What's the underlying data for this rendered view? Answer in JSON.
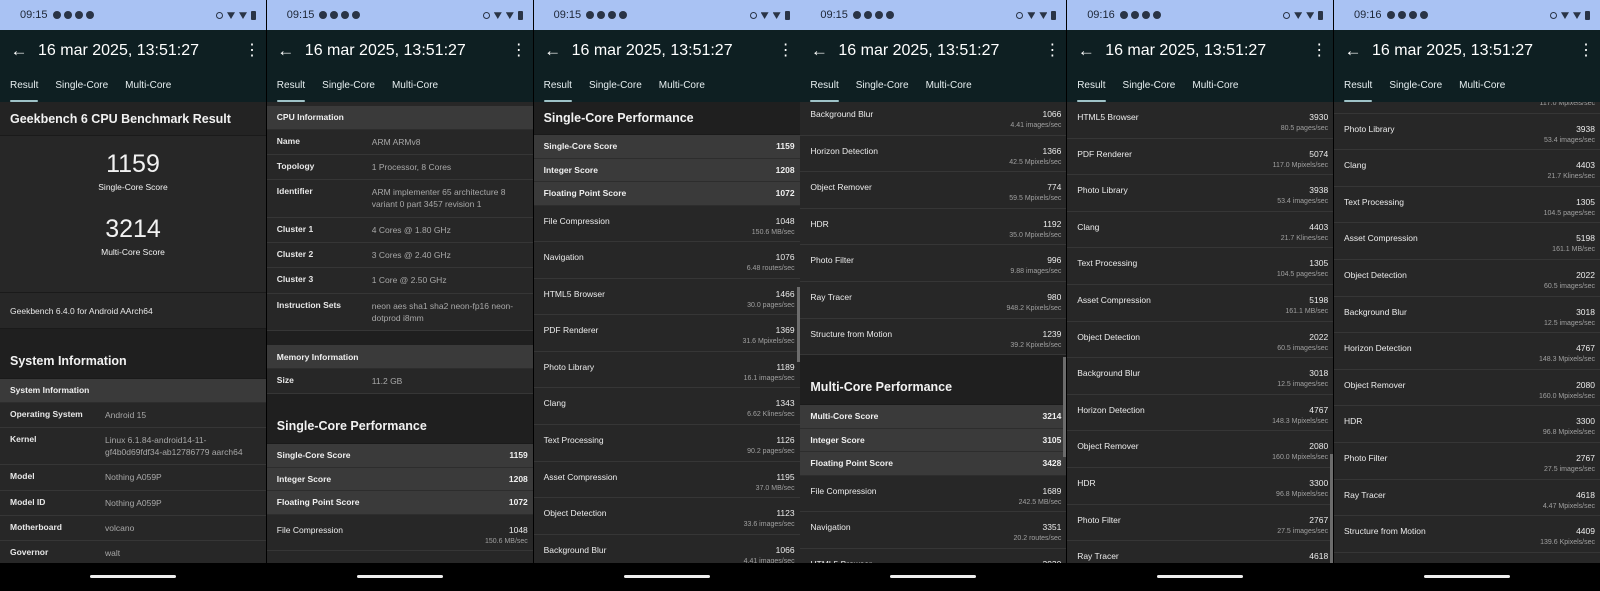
{
  "status": {
    "times": [
      "09:15",
      "09:15",
      "09:15",
      "09:15",
      "09:16",
      "09:16"
    ]
  },
  "app": {
    "title": "16 mar 2025, 13:51:27",
    "tabs": [
      "Result",
      "Single-Core",
      "Multi-Core"
    ],
    "active_tab": "Result"
  },
  "result": {
    "heading": "Geekbench 6 CPU Benchmark Result",
    "single_score": "1159",
    "single_label": "Single-Core Score",
    "multi_score": "3214",
    "multi_label": "Multi-Core Score",
    "version": "Geekbench 6.4.0 for Android AArch64"
  },
  "system": {
    "heading": "System Information",
    "subheading": "System Information",
    "rows": [
      {
        "k": "Operating System",
        "v": "Android 15"
      },
      {
        "k": "Kernel",
        "v": "Linux 6.1.84-android14-11-gf4b0d69fdf34-ab12786779 aarch64"
      },
      {
        "k": "Model",
        "v": "Nothing A059P"
      },
      {
        "k": "Model ID",
        "v": "Nothing A059P"
      },
      {
        "k": "Motherboard",
        "v": "volcano"
      },
      {
        "k": "Governor",
        "v": "walt"
      }
    ]
  },
  "cpu": {
    "heading": "CPU Information",
    "rows": [
      {
        "k": "Name",
        "v": "ARM ARMv8"
      },
      {
        "k": "Topology",
        "v": "1 Processor, 8 Cores"
      },
      {
        "k": "Identifier",
        "v": "ARM implementer 65 architecture 8 variant 0 part 3457 revision 1"
      },
      {
        "k": "Cluster 1",
        "v": "4 Cores @ 1.80 GHz"
      },
      {
        "k": "Cluster 2",
        "v": "3 Cores @ 2.40 GHz"
      },
      {
        "k": "Cluster 3",
        "v": "1 Core @ 2.50 GHz"
      },
      {
        "k": "Instruction Sets",
        "v": "neon aes sha1 sha2 neon-fp16 neon-dotprod i8mm"
      }
    ]
  },
  "memory": {
    "heading": "Memory Information",
    "rows": [
      {
        "k": "Size",
        "v": "11.2 GB"
      }
    ]
  },
  "single": {
    "heading": "Single-Core Performance",
    "summary": [
      {
        "n": "Single-Core Score",
        "s": "1159"
      },
      {
        "n": "Integer Score",
        "s": "1208"
      },
      {
        "n": "Floating Point Score",
        "s": "1072"
      }
    ],
    "rows": [
      {
        "n": "File Compression",
        "s": "1048",
        "u": "150.6 MB/sec"
      },
      {
        "n": "Navigation",
        "s": "1076",
        "u": "6.48 routes/sec"
      },
      {
        "n": "HTML5 Browser",
        "s": "1466",
        "u": "30.0 pages/sec"
      },
      {
        "n": "PDF Renderer",
        "s": "1369",
        "u": "31.6 Mpixels/sec"
      },
      {
        "n": "Photo Library",
        "s": "1189",
        "u": "16.1 images/sec"
      },
      {
        "n": "Clang",
        "s": "1343",
        "u": "6.62 Klines/sec"
      },
      {
        "n": "Text Processing",
        "s": "1126",
        "u": "90.2 pages/sec"
      },
      {
        "n": "Asset Compression",
        "s": "1195",
        "u": "37.0 MB/sec"
      },
      {
        "n": "Object Detection",
        "s": "1123",
        "u": "33.6 images/sec"
      },
      {
        "n": "Background Blur",
        "s": "1066",
        "u": "4.41 images/sec"
      },
      {
        "n": "Horizon Detection",
        "s": "1366",
        "u": "42.5 Mpixels/sec"
      },
      {
        "n": "Object Remover",
        "s": "774",
        "u": "59.5 Mpixels/sec"
      },
      {
        "n": "HDR",
        "s": "1192",
        "u": "35.0 Mpixels/sec"
      },
      {
        "n": "Photo Filter",
        "s": "996",
        "u": "9.88 images/sec"
      },
      {
        "n": "Ray Tracer",
        "s": "980",
        "u": "948.2 Kpixels/sec"
      },
      {
        "n": "Structure from Motion",
        "s": "1239",
        "u": "39.2 Kpixels/sec"
      }
    ]
  },
  "multi": {
    "heading": "Multi-Core Performance",
    "summary": [
      {
        "n": "Multi-Core Score",
        "s": "3214"
      },
      {
        "n": "Integer Score",
        "s": "3105"
      },
      {
        "n": "Floating Point Score",
        "s": "3428"
      }
    ],
    "rows": [
      {
        "n": "File Compression",
        "s": "1689",
        "u": "242.5 MB/sec"
      },
      {
        "n": "Navigation",
        "s": "3351",
        "u": "20.2 routes/sec"
      },
      {
        "n": "HTML5 Browser",
        "s": "3930",
        "u": "80.5 pages/sec"
      },
      {
        "n": "PDF Renderer",
        "s": "5074",
        "u": "117.0 Mpixels/sec"
      },
      {
        "n": "Photo Library",
        "s": "3938",
        "u": "53.4 images/sec"
      },
      {
        "n": "Clang",
        "s": "4403",
        "u": "21.7 Klines/sec"
      },
      {
        "n": "Text Processing",
        "s": "1305",
        "u": "104.5 pages/sec"
      },
      {
        "n": "Asset Compression",
        "s": "5198",
        "u": "161.1 MB/sec"
      },
      {
        "n": "Object Detection",
        "s": "2022",
        "u": "60.5 images/sec"
      },
      {
        "n": "Background Blur",
        "s": "3018",
        "u": "12.5 images/sec"
      },
      {
        "n": "Horizon Detection",
        "s": "4767",
        "u": "148.3 Mpixels/sec"
      },
      {
        "n": "Object Remover",
        "s": "2080",
        "u": "160.0 Mpixels/sec"
      },
      {
        "n": "HDR",
        "s": "3300",
        "u": "96.8 Mpixels/sec"
      },
      {
        "n": "Photo Filter",
        "s": "2767",
        "u": "27.5 images/sec"
      },
      {
        "n": "Ray Tracer",
        "s": "4618",
        "u": "4.47 Mpixels/sec"
      },
      {
        "n": "Structure from Motion",
        "s": "4409",
        "u": "139.6 Kpixels/sec"
      }
    ]
  }
}
